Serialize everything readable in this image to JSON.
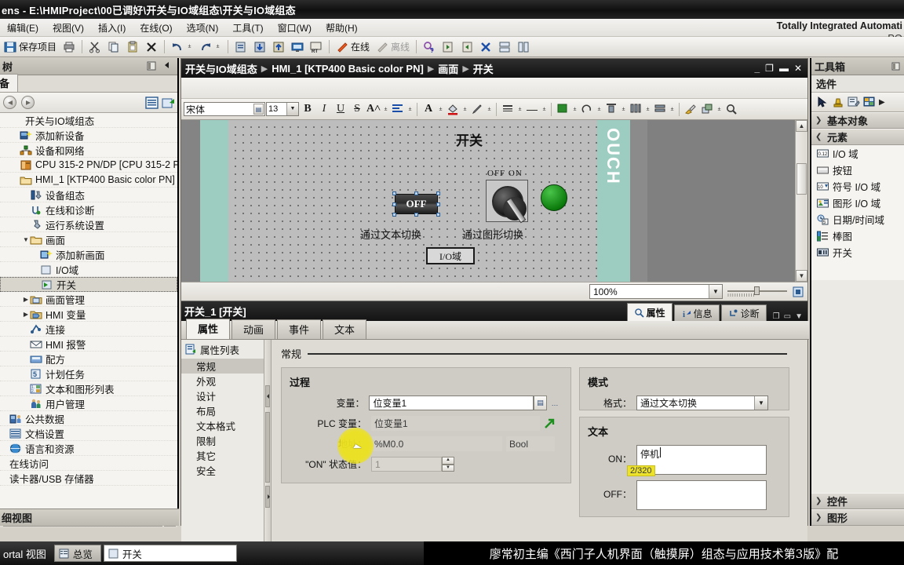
{
  "window": {
    "title": "ens  -  E:\\HMIProject\\00已调好\\开关与IO域组态\\开关与IO域组态"
  },
  "menubar": {
    "items": [
      {
        "label": "编辑(E)"
      },
      {
        "label": "视图(V)"
      },
      {
        "label": "插入(I)"
      },
      {
        "label": "在线(O)"
      },
      {
        "label": "选项(N)"
      },
      {
        "label": "工具(T)"
      },
      {
        "label": "窗口(W)"
      },
      {
        "label": "帮助(H)"
      }
    ],
    "brand_line1": "Totally Integrated Automati",
    "brand_line2": "PO"
  },
  "toolbar": {
    "save_label": "保存项目",
    "online_label": "在线",
    "offline_label": "离线"
  },
  "tree": {
    "panel_title": "树",
    "tab_label": "备",
    "nodes": [
      {
        "label": "开关与IO域组态",
        "indent": 0,
        "icon": "project-icon",
        "twisty": "",
        "selected": false
      },
      {
        "label": "添加新设备",
        "indent": 1,
        "icon": "add-device-icon",
        "twisty": "",
        "selected": false
      },
      {
        "label": "设备和网络",
        "indent": 1,
        "icon": "devices-networks-icon",
        "twisty": "",
        "selected": false
      },
      {
        "label": "CPU 315-2 PN/DP [CPU 315-2 P...",
        "indent": 1,
        "icon": "plc-icon",
        "twisty": "",
        "selected": false
      },
      {
        "label": "HMI_1 [KTP400 Basic color PN]",
        "indent": 1,
        "icon": "hmi-folder-icon",
        "twisty": "",
        "selected": false
      },
      {
        "label": "设备组态",
        "indent": 2,
        "icon": "device-config-icon",
        "twisty": "",
        "selected": false
      },
      {
        "label": "在线和诊断",
        "indent": 2,
        "icon": "online-diagnostics-icon",
        "twisty": "",
        "selected": false
      },
      {
        "label": "运行系统设置",
        "indent": 2,
        "icon": "runtime-settings-icon",
        "twisty": "",
        "selected": false
      },
      {
        "label": "画面",
        "indent": 2,
        "icon": "screens-folder-icon",
        "twisty": "▼",
        "selected": false
      },
      {
        "label": "添加新画面",
        "indent": 3,
        "icon": "add-screen-icon",
        "twisty": "",
        "selected": false
      },
      {
        "label": "I/O域",
        "indent": 3,
        "icon": "screen-icon",
        "twisty": "",
        "selected": false
      },
      {
        "label": "开关",
        "indent": 3,
        "icon": "screen-active-icon",
        "twisty": "",
        "selected": true
      },
      {
        "label": "画面管理",
        "indent": 2,
        "icon": "screen-management-icon",
        "twisty": "▶",
        "selected": false
      },
      {
        "label": "HMI 变量",
        "indent": 2,
        "icon": "hmi-tags-icon",
        "twisty": "▶",
        "selected": false
      },
      {
        "label": "连接",
        "indent": 2,
        "icon": "connections-icon",
        "twisty": "",
        "selected": false
      },
      {
        "label": "HMI 报警",
        "indent": 2,
        "icon": "alarms-icon",
        "twisty": "",
        "selected": false
      },
      {
        "label": "配方",
        "indent": 2,
        "icon": "recipes-icon",
        "twisty": "",
        "selected": false
      },
      {
        "label": "计划任务",
        "indent": 2,
        "icon": "scheduled-tasks-icon",
        "twisty": "",
        "selected": false
      },
      {
        "label": "文本和图形列表",
        "indent": 2,
        "icon": "text-graphic-lists-icon",
        "twisty": "",
        "selected": false
      },
      {
        "label": "用户管理",
        "indent": 2,
        "icon": "user-admin-icon",
        "twisty": "",
        "selected": false
      },
      {
        "label": "公共数据",
        "indent": 0,
        "icon": "common-data-icon",
        "twisty": "",
        "selected": false
      },
      {
        "label": "文档设置",
        "indent": 0,
        "icon": "doc-settings-icon",
        "twisty": "",
        "selected": false
      },
      {
        "label": "语言和资源",
        "indent": 0,
        "icon": "languages-resources-icon",
        "twisty": "",
        "selected": false
      },
      {
        "label": "在线访问",
        "indent": 0,
        "icon": "",
        "twisty": "",
        "selected": false
      },
      {
        "label": "读卡器/USB 存储器",
        "indent": 0,
        "icon": "",
        "twisty": "",
        "selected": false
      }
    ],
    "detail_view_label": "细视图"
  },
  "editor": {
    "breadcrumb": [
      "开关与IO域组态",
      "HMI_1 [KTP400 Basic color PN]",
      "画面",
      "开关"
    ],
    "font_name": "宋体",
    "font_size": "13",
    "canvas": {
      "touch_label": "OUCH",
      "screen_title": "开关",
      "switch_onoff_label": "OFF   ON",
      "text_switch_value": "OFF",
      "caption_text_switch": "通过文本切换",
      "caption_graphic_switch": "通过图形切换",
      "io_field_label": "I/O域"
    },
    "zoom_value": "100%"
  },
  "status": {
    "object_title": "开关_1 [开关]",
    "tabs": [
      {
        "label": "属性",
        "active": true,
        "icon": "properties-icon"
      },
      {
        "label": "信息",
        "active": false,
        "icon": "info-icon"
      },
      {
        "label": "诊断",
        "active": false,
        "icon": "diagnostics-icon"
      }
    ]
  },
  "properties": {
    "tabs": [
      {
        "label": "属性",
        "active": true
      },
      {
        "label": "动画",
        "active": false
      },
      {
        "label": "事件",
        "active": false
      },
      {
        "label": "文本",
        "active": false
      }
    ],
    "list_header": "属性列表",
    "list_items": [
      {
        "label": "常规",
        "selected": true
      },
      {
        "label": "外观",
        "selected": false
      },
      {
        "label": "设计",
        "selected": false
      },
      {
        "label": "布局",
        "selected": false
      },
      {
        "label": "文本格式",
        "selected": false
      },
      {
        "label": "限制",
        "selected": false
      },
      {
        "label": "其它",
        "selected": false
      },
      {
        "label": "安全",
        "selected": false
      }
    ],
    "section_title": "常规",
    "process": {
      "title": "过程",
      "tag_label": "变量：",
      "tag_value": "位变量1",
      "plc_tag_label": "PLC 变量：",
      "plc_tag_value": "位变量1",
      "address_label": "地址：",
      "address_value": "%M0.0",
      "address_type": "Bool",
      "on_state_label": "\"ON\" 状态值：",
      "on_state_value": "1"
    },
    "mode": {
      "title": "模式",
      "format_label": "格式：",
      "format_value": "通过文本切换"
    },
    "text": {
      "title": "文本",
      "on_label": "ON：",
      "on_value": "停机",
      "off_label": "OFF：",
      "off_value": "",
      "tooltip_badge": "2/320"
    }
  },
  "toolbox": {
    "title": "工具箱",
    "subtitle": "选件",
    "groups": [
      {
        "label": "基本对象",
        "expanded": false,
        "items": []
      },
      {
        "label": "元素",
        "expanded": true,
        "items": [
          {
            "label": "I/O 域",
            "icon": "io-field-icon"
          },
          {
            "label": "按钮",
            "icon": "button-icon"
          },
          {
            "label": "符号 I/O 域",
            "icon": "symbolic-io-field-icon"
          },
          {
            "label": "图形 I/O 域",
            "icon": "graphic-io-field-icon"
          },
          {
            "label": "日期/时间域",
            "icon": "date-time-field-icon"
          },
          {
            "label": "棒图",
            "icon": "bar-graph-icon"
          },
          {
            "label": "开关",
            "icon": "switch-icon"
          }
        ]
      },
      {
        "label": "控件",
        "expanded": false,
        "items": []
      },
      {
        "label": "图形",
        "expanded": false,
        "items": []
      }
    ]
  },
  "bottom": {
    "portal_label": "ortal 视图",
    "tasks": [
      {
        "label": "总览",
        "active": false,
        "icon": "overview-icon"
      },
      {
        "label": "开关",
        "active": true,
        "icon": "screen-icon"
      }
    ],
    "banner": "廖常初主编《西门子人机界面（触摸屏）组态与应用技术第3版》配"
  },
  "colors": {
    "accent": "#9ccdc0",
    "lamp_green": "#0b7a0b",
    "highlight_yellow": "#ece22c"
  }
}
